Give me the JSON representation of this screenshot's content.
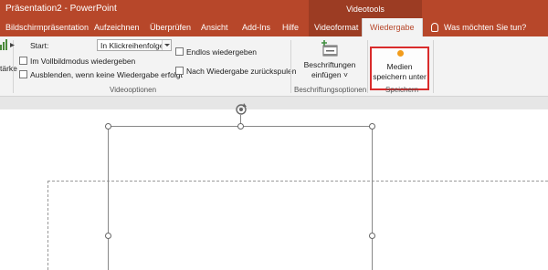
{
  "window": {
    "title": "Präsentation2 - PowerPoint",
    "context_header": "Videotools"
  },
  "tabs": [
    {
      "label": "Bildschirmpräsentation"
    },
    {
      "label": "Aufzeichnen"
    },
    {
      "label": "Überprüfen"
    },
    {
      "label": "Ansicht"
    },
    {
      "label": "Add-Ins"
    },
    {
      "label": "Hilfe"
    },
    {
      "label": "Videoformat"
    },
    {
      "label": "Wiedergabe"
    }
  ],
  "tell_me": "Was möchten Sie tun?",
  "videooptions": {
    "cut_label": "tärke",
    "start_label": "Start:",
    "start_value": "In Klickreihenfolge",
    "fullscreen": "Im Vollbildmodus wiedergeben",
    "hide": "Ausblenden, wenn keine Wiedergabe erfolgt",
    "loop": "Endlos wiedergeben",
    "rewind": "Nach Wiedergabe zurückspulen",
    "group_label": "Videooptionen"
  },
  "captions": {
    "line1": "Beschriftungen",
    "line2": "einfügen ˅",
    "group_label": "Beschriftungsoptionen"
  },
  "save": {
    "line1": "Medien",
    "line2": "speichern unter",
    "group_label": "Speichern"
  },
  "colors": {
    "accent": "#b7472a",
    "highlight": "#d92b2b",
    "media_icon": "#f29c1c"
  }
}
